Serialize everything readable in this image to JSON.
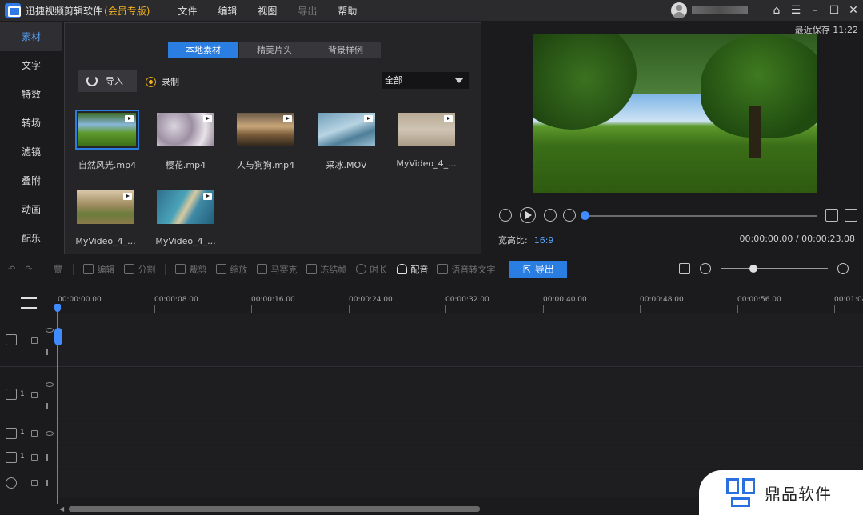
{
  "titlebar": {
    "app_name": "迅捷视频剪辑软件",
    "app_vip": "(会员专版)",
    "menu": [
      "文件",
      "编辑",
      "视图",
      "导出",
      "帮助"
    ]
  },
  "sidebar": {
    "items": [
      "素材",
      "文字",
      "特效",
      "转场",
      "滤镜",
      "叠附",
      "动画",
      "配乐"
    ]
  },
  "media": {
    "tabs": [
      "本地素材",
      "精美片头",
      "背景样例"
    ],
    "import_label": "导入",
    "record_label": "录制",
    "filter_selected": "全部",
    "files": [
      "自然风光.mp4",
      "樱花.mp4",
      "人与狗狗.mp4",
      "采冰.MOV",
      "MyVideo_4_...",
      "MyVideo_4_...",
      "MyVideo_4_..."
    ]
  },
  "preview": {
    "saved_text": "最近保存 11:22",
    "aspect_label": "宽高比:",
    "aspect_value": "16:9",
    "timecode": "00:00:00.00 / 00:00:23.08",
    "progress": 0
  },
  "toolbar": {
    "edit": "编辑",
    "split": "分割",
    "crop": "裁剪",
    "zoom": "缩放",
    "mosaic": "马赛克",
    "freeze": "冻结帧",
    "duration": "时长",
    "dub": "配音",
    "speech_to_text": "语音转文字",
    "export": "导出"
  },
  "timeline": {
    "ticks": [
      "00:00:00.00",
      "00:00:08.00",
      "00:00:16.00",
      "00:00:24.00",
      "00:00:32.00",
      "00:00:40.00",
      "00:00:48.00",
      "00:00:56.00",
      "00:01:04"
    ],
    "track_numbers": [
      "1",
      "1",
      "1"
    ]
  },
  "watermark": {
    "text": "鼎品软件"
  },
  "colors": {
    "accent": "#2a7de1",
    "vip": "#f3b21f",
    "bg": "#1b1b1d"
  }
}
